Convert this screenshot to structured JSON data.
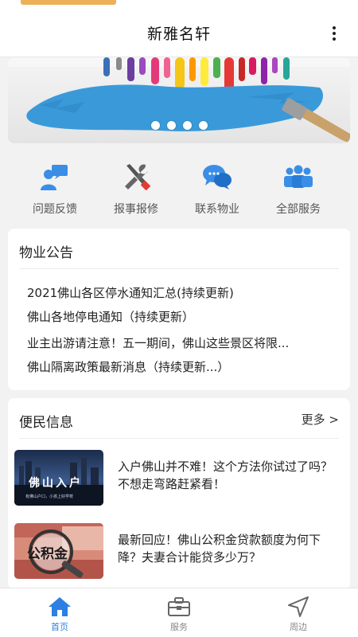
{
  "header": {
    "title": "新雅名轩"
  },
  "banner": {
    "slide_count": 4,
    "active_slide": 0
  },
  "quick_actions": [
    {
      "label": "问题反馈",
      "icon": "feedback-person-icon"
    },
    {
      "label": "报事报修",
      "icon": "wrench-screwdriver-icon"
    },
    {
      "label": "联系物业",
      "icon": "chat-bubbles-icon"
    },
    {
      "label": "全部服务",
      "icon": "people-group-icon"
    }
  ],
  "announcements": {
    "title": "物业公告",
    "items": [
      "2021佛山各区停水通知汇总(持续更新)",
      "佛山各地停电通知（持续更新）",
      "业主出游请注意！五一期间，佛山这些景区将限...",
      "佛山隔离政策最新消息（持续更新...）"
    ]
  },
  "info": {
    "title": "便民信息",
    "more_label": "更多 >",
    "articles": [
      {
        "title": "入户佛山并不难！这个方法你试过了吗？不想走弯路赶紧看！",
        "thumb_text": "佛山入户",
        "thumb_subtext": "有佛山户口，小孩上好学校"
      },
      {
        "title": "最新回应！佛山公积金贷款额度为何下降？夫妻合计能贷多少万？",
        "thumb_text": "公积金"
      }
    ]
  },
  "tabbar": {
    "tabs": [
      {
        "label": "首页",
        "icon": "home-icon",
        "active": true
      },
      {
        "label": "服务",
        "icon": "toolbox-icon",
        "active": false
      },
      {
        "label": "周边",
        "icon": "navigation-arrow-icon",
        "active": false
      }
    ]
  },
  "colors": {
    "accent": "#2d7fe3",
    "icon_blue": "#3a8ee6",
    "background": "#f2f2f2"
  }
}
